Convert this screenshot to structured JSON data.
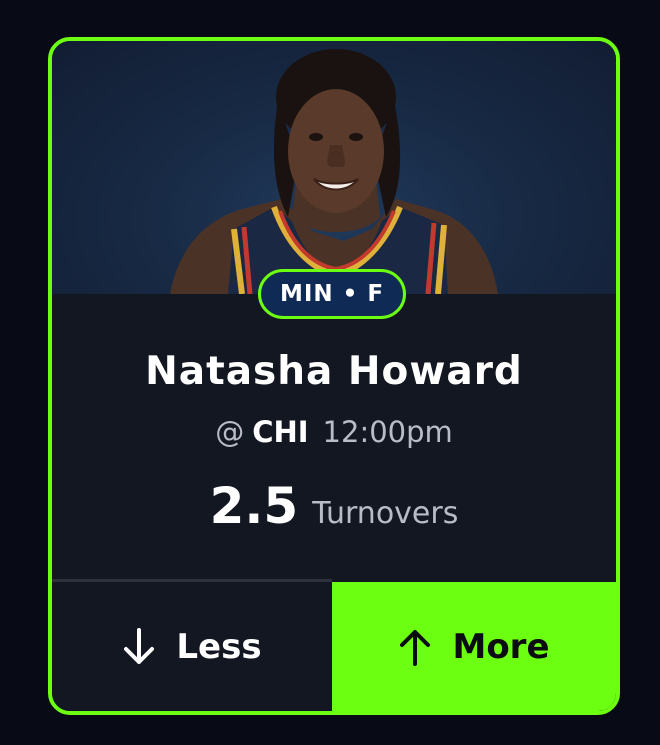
{
  "card": {
    "badge": "MIN • F",
    "player_name": "Natasha Howard",
    "matchup": {
      "at": "@",
      "opponent": "CHI",
      "time": "12:00pm"
    },
    "line": {
      "value": "2.5",
      "stat": "Turnovers"
    },
    "buttons": {
      "less_label": "Less",
      "more_label": "More"
    }
  },
  "colors": {
    "accent": "#6cff12",
    "card_bg": "#131722",
    "page_bg": "#080b15",
    "badge_bg": "#0f2a55"
  },
  "icons": {
    "less": "arrow-down-icon",
    "more": "arrow-up-icon"
  }
}
